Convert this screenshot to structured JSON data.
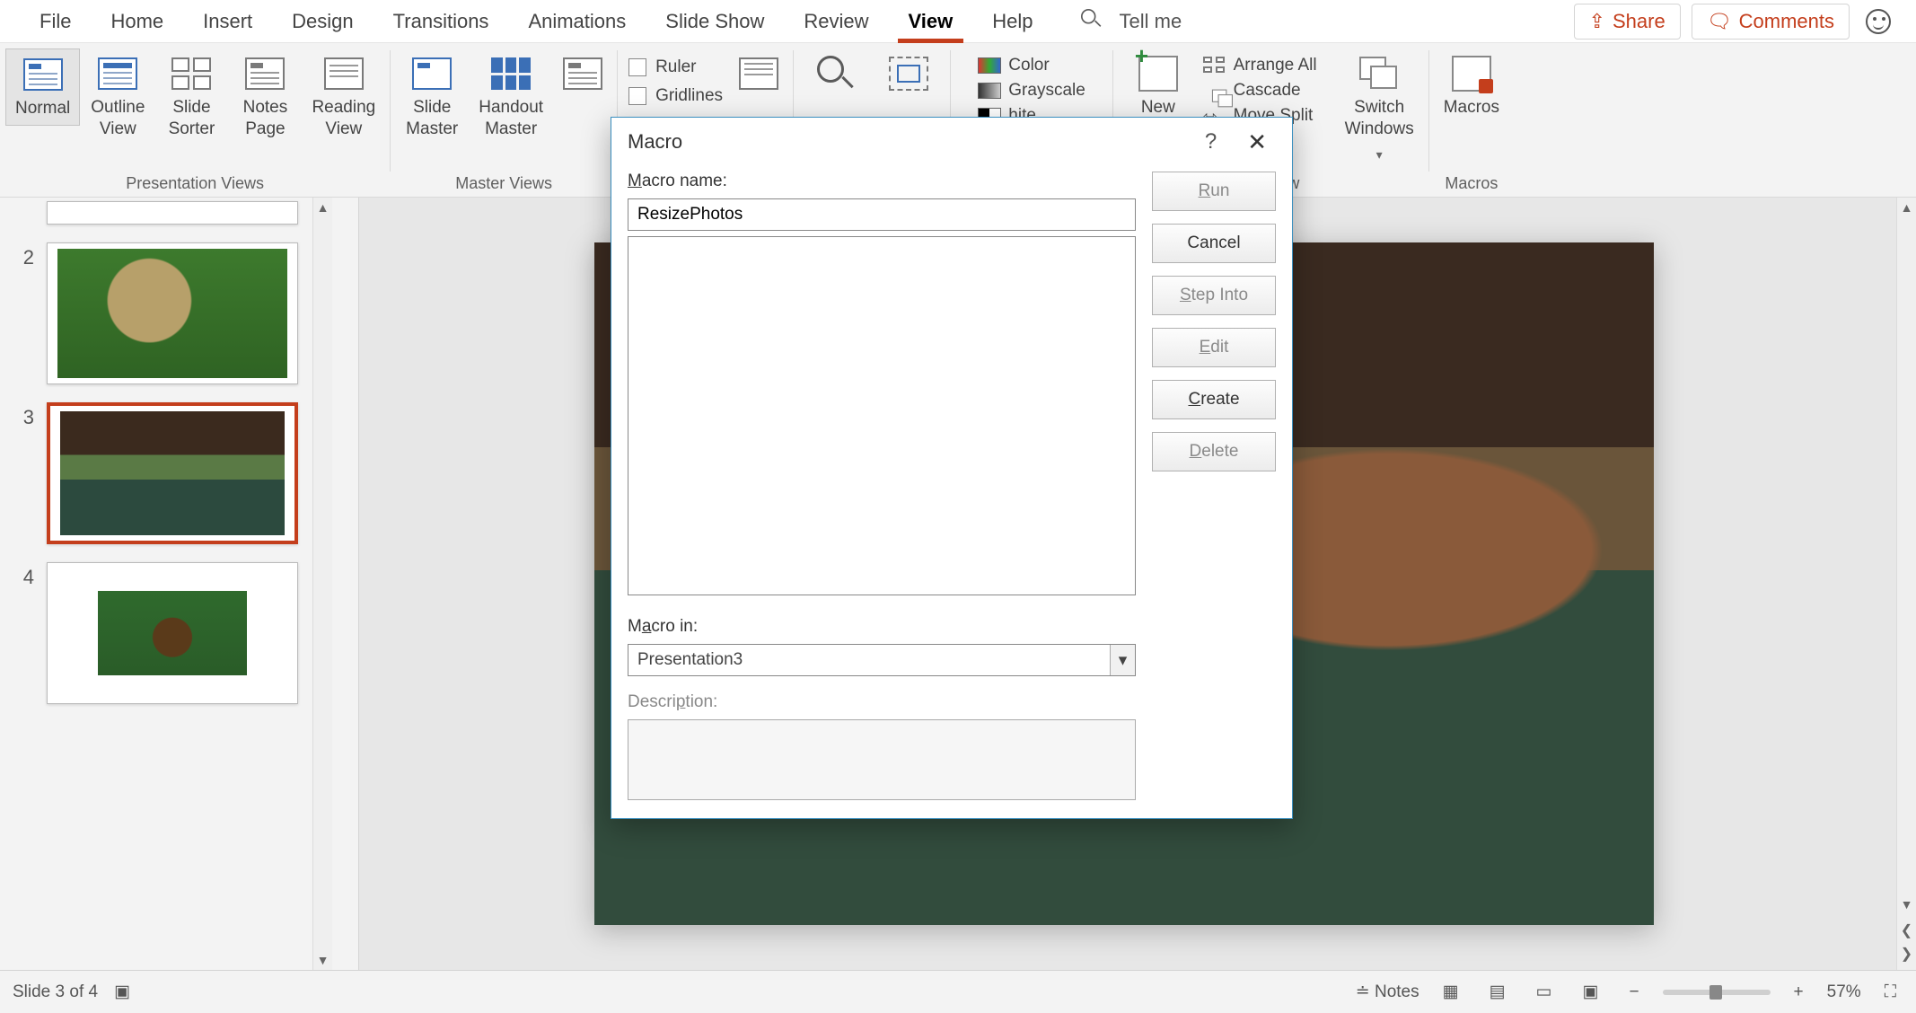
{
  "tabs": {
    "file": "File",
    "home": "Home",
    "insert": "Insert",
    "design": "Design",
    "transitions": "Transitions",
    "animations": "Animations",
    "slideshow": "Slide Show",
    "review": "Review",
    "view": "View",
    "help": "Help",
    "tell_me": "Tell me"
  },
  "header": {
    "share": "Share",
    "comments": "Comments"
  },
  "ribbon": {
    "presentation_views": {
      "label": "Presentation Views",
      "normal": "Normal",
      "outline": "Outline\nView",
      "sorter": "Slide\nSorter",
      "notes": "Notes\nPage",
      "reading": "Reading\nView"
    },
    "master_views": {
      "label": "Master Views",
      "slide_master": "Slide\nMaster",
      "handout_master": "Handout\nMaster"
    },
    "show": {
      "ruler": "Ruler",
      "gridlines": "Gridlines"
    },
    "zoom": {
      "zoom": "Zoom",
      "fit": "Fit"
    },
    "color": {
      "color": "Color",
      "grayscale": "Grayscale",
      "bw": "hite"
    },
    "window": {
      "label": "Window",
      "new": "New\nWindow",
      "arrange": "Arrange All",
      "cascade": "Cascade",
      "move_split": "Move Split",
      "switch": "Switch\nWindows"
    },
    "macros": {
      "label": "Macros",
      "macros": "Macros"
    }
  },
  "thumbs": {
    "n2": "2",
    "n3": "3",
    "n4": "4"
  },
  "dialog": {
    "title": "Macro",
    "macro_name_label": "Macro name:",
    "macro_name": "ResizePhotos",
    "macro_in_label": "Macro in:",
    "macro_in": "Presentation3",
    "description_label": "Description:",
    "run": "Run",
    "cancel": "Cancel",
    "step_into": "Step Into",
    "edit": "Edit",
    "create": "Create",
    "delete": "Delete",
    "help": "?",
    "close": "✕"
  },
  "status": {
    "slide": "Slide 3 of 4",
    "notes": "Notes",
    "zoom": "57%"
  }
}
